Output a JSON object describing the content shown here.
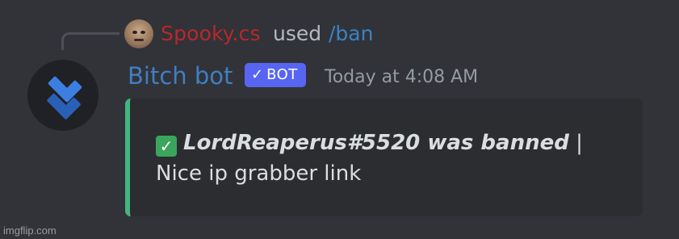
{
  "reply": {
    "username": "Spooky.cs",
    "used_text": "used",
    "command": "/ban"
  },
  "message": {
    "author": "Bitch bot",
    "bot_tag": "BOT",
    "bot_tag_check": "✓",
    "timestamp": "Today at 4:08 AM"
  },
  "embed": {
    "check_glyph": "✓",
    "bold_text": "LordReaperus#5520 was banned",
    "separator": "|",
    "reason": "Nice ip grabber link",
    "accent_color": "#43b581"
  },
  "watermark": "imgflip.com",
  "colors": {
    "background": "#313338",
    "reply_username": "#b8282c",
    "command": "#3b82c4",
    "author": "#3f7fc2",
    "bot_tag_bg": "#5865f2"
  },
  "icons": {
    "reply_avatar": "user-avatar-face",
    "bot_avatar": "double-chevron-logo"
  }
}
